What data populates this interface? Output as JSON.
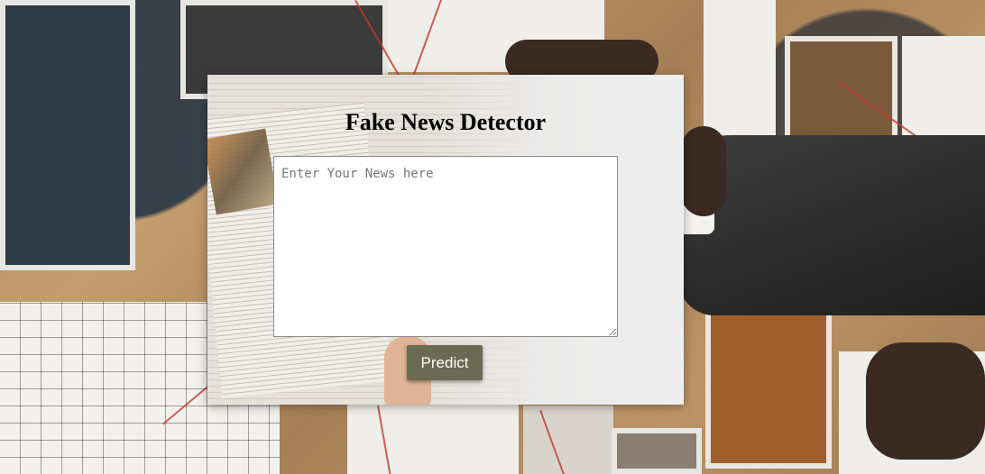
{
  "page": {
    "title": "Fake News Detector"
  },
  "form": {
    "news_placeholder": "Enter Your News here",
    "news_value": "",
    "predict_label": "Predict"
  },
  "colors": {
    "button_background": "#6b6a52",
    "button_text": "#ffffff",
    "title_text": "#000000"
  }
}
